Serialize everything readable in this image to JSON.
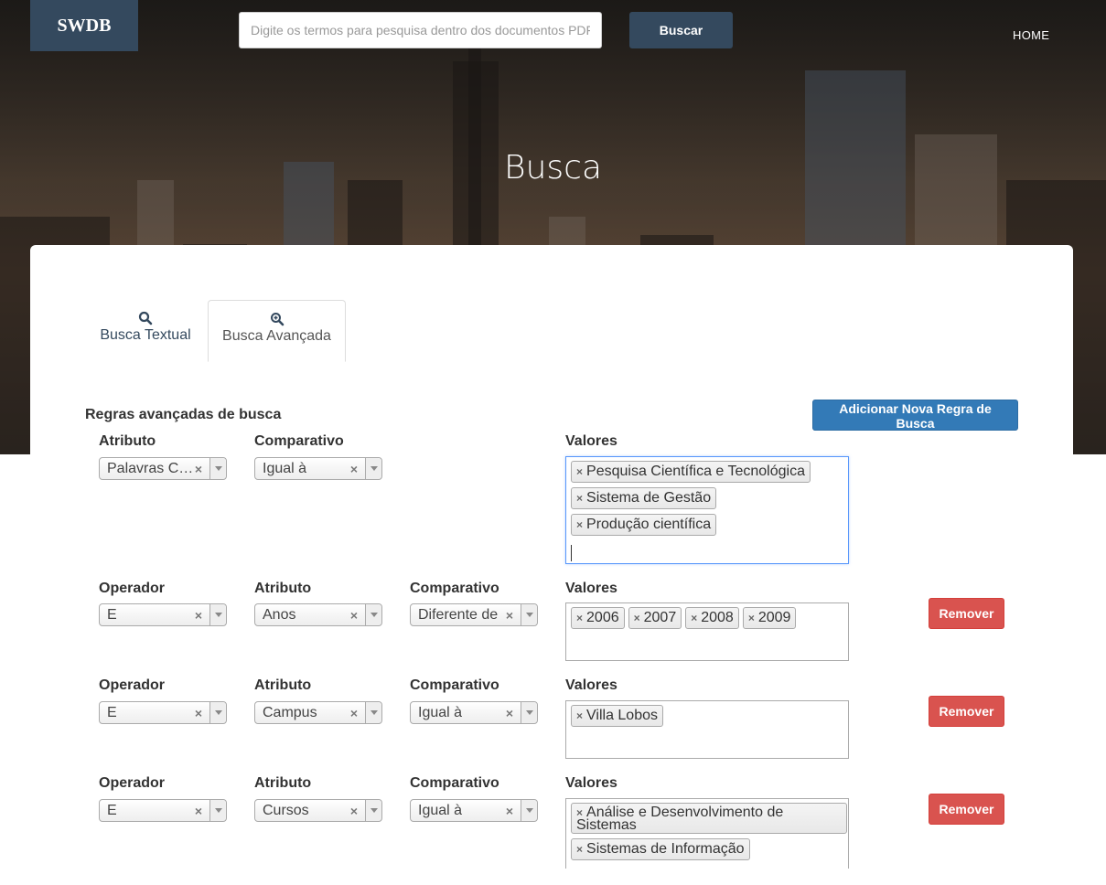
{
  "header": {
    "brand": "SWDB",
    "search_placeholder": "Digite os termos para pesquisa dentro dos documentos PDF",
    "search_button": "Buscar",
    "nav_home": "HOME"
  },
  "page_title": "Busca",
  "tabs": [
    {
      "label": "Busca Textual",
      "icon": "search-icon",
      "active": false
    },
    {
      "label": "Busca Avançada",
      "icon": "zoom-in-icon",
      "active": true
    }
  ],
  "advanced": {
    "section_title": "Regras avançadas de busca",
    "add_rule_button": "Adicionar Nova Regra de Busca",
    "labels": {
      "operator": "Operador",
      "attribute": "Atributo",
      "comparative": "Comparativo",
      "values": "Valores"
    },
    "remove_button": "Remover",
    "rules": [
      {
        "attribute": "Palavras Ch...",
        "comparative": "Igual à",
        "values": [
          "Pesquisa Científica e Tecnológica",
          "Sistema de Gestão",
          "Produção científica"
        ]
      },
      {
        "operator": "E",
        "attribute": "Anos",
        "comparative": "Diferente de",
        "values": [
          "2006",
          "2007",
          "2008",
          "2009"
        ]
      },
      {
        "operator": "E",
        "attribute": "Campus",
        "comparative": "Igual à",
        "values": [
          "Villa Lobos"
        ]
      },
      {
        "operator": "E",
        "attribute": "Cursos",
        "comparative": "Igual à",
        "values": [
          "Análise e Desenvolvimento de Sistemas",
          "Sistemas de Informação"
        ]
      }
    ]
  },
  "colors": {
    "brand": "#34495e",
    "primary": "#337ab7",
    "danger": "#d9534f"
  }
}
